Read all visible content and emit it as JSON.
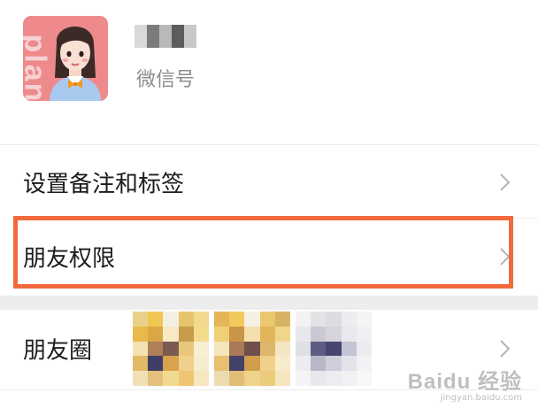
{
  "profile": {
    "wechat_id_label": "微信号",
    "avatar_text": "plan"
  },
  "menu": {
    "remark_tags": "设置备注和标签",
    "friend_permissions": "朋友权限",
    "moments": "朋友圈"
  },
  "colors": {
    "highlight": "#f26a3c",
    "avatar_bg": "#ee8a8c"
  },
  "watermark": {
    "main": "Baidu 经验",
    "sub": "jingyan.baidu.com"
  }
}
